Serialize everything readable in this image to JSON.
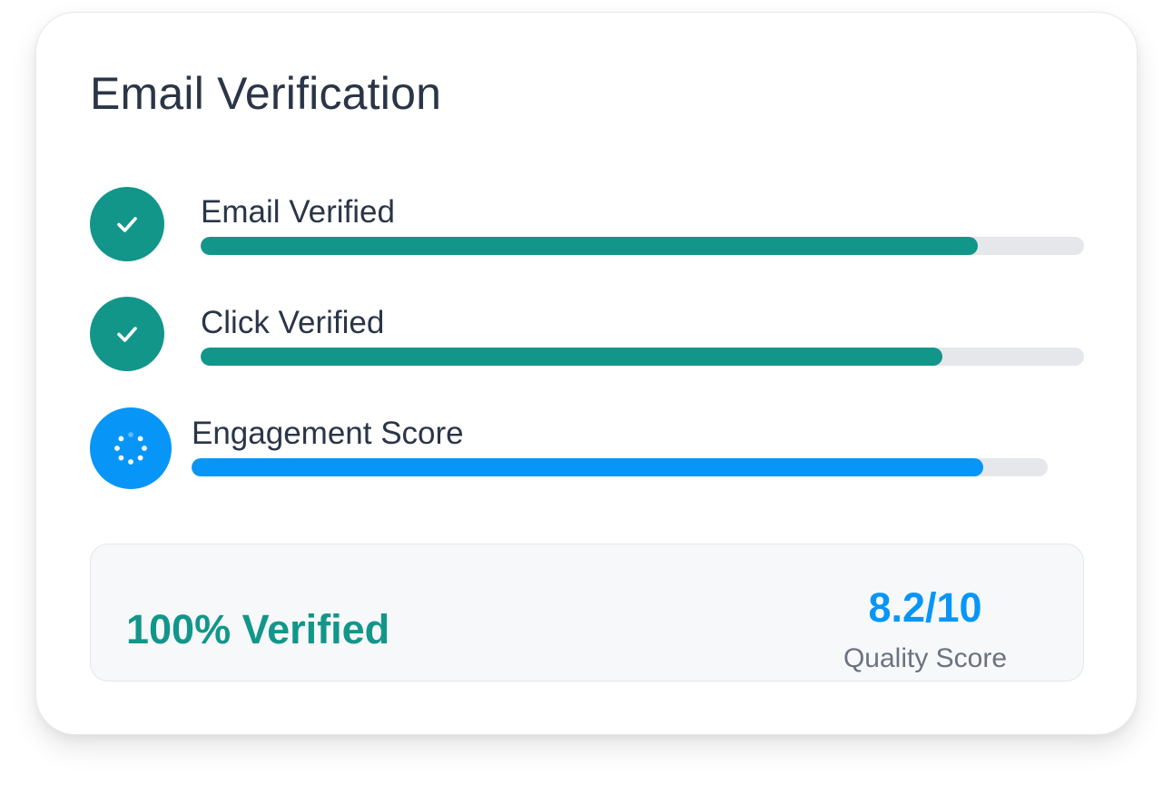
{
  "card": {
    "title": "Email Verification"
  },
  "checks": [
    {
      "label": "Email Verified",
      "status": "complete",
      "icon": "check-icon",
      "progress_percent": 88,
      "color": "#12968a"
    },
    {
      "label": "Click Verified",
      "status": "complete",
      "icon": "check-icon",
      "progress_percent": 84,
      "color": "#12968a"
    },
    {
      "label": "Engagement Score",
      "status": "in-progress",
      "icon": "loading-spinner-icon",
      "progress_percent": 92.5,
      "color": "#0796f7"
    }
  ],
  "summary": {
    "verified_text": "100% Verified",
    "score_value": "8.2/10",
    "score_label": "Quality Score"
  },
  "colors": {
    "complete": "#12968a",
    "in_progress": "#0796f7",
    "track": "#e6e7eb",
    "title_text": "#2a3547"
  }
}
